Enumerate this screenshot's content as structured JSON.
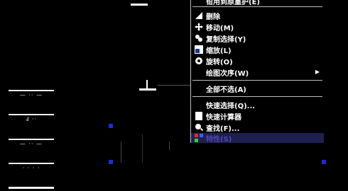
{
  "colors": {
    "background": "#000000",
    "menu_border": "#bdbdbd",
    "grip": "#1f2bd6",
    "highlight": "#1f1f4f"
  },
  "left_panel": {
    "items": [
      {
        "label": "— ·· —"
      },
      {
        "label": "Ⅎ ··"
      },
      {
        "label": "— ·· —"
      },
      {
        "label": "· · · ·"
      }
    ]
  },
  "menu": {
    "top_partial": "钳用到原重护(E)",
    "items": [
      {
        "label": "删除",
        "icon": "eraser-icon"
      },
      {
        "label": "移动(M)",
        "icon": "move-icon"
      },
      {
        "label": "复制选择(Y)",
        "icon": "copy-icon"
      },
      {
        "label": "缩放(L)",
        "icon": "scale-icon"
      },
      {
        "label": "旋转(O)",
        "icon": "rotate-icon"
      },
      {
        "label": "绘图次序(W)",
        "icon": "",
        "submenu": true
      },
      {
        "label": "全部不选(A)",
        "icon": ""
      },
      {
        "label": "快速选择(Q)...",
        "icon": ""
      },
      {
        "label": "快速计算器",
        "icon": "calculator-icon"
      },
      {
        "label": "查找(F)...",
        "icon": "find-icon"
      },
      {
        "label": "特性(S)",
        "icon": "properties-icon"
      }
    ],
    "submenu_arrow": "▶"
  }
}
